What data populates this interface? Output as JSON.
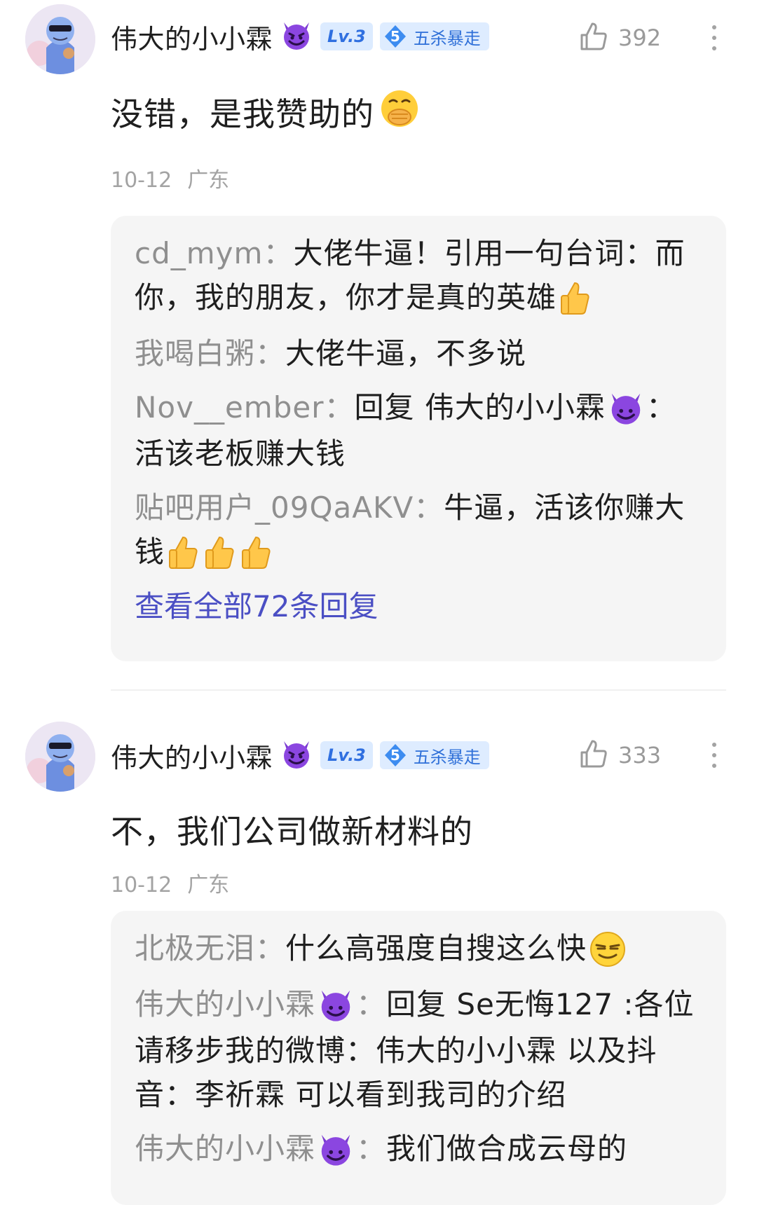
{
  "comments": [
    {
      "username": "伟大的小小霖",
      "level": "Lv.3",
      "title_level": "5",
      "title_text": "五杀暴走",
      "likes": "392",
      "content": "没错，是我赞助的",
      "date": "10-12",
      "location": "广东",
      "replies": [
        {
          "author": "cd_mym",
          "sep": "：",
          "text": "大佬牛逼！引用一句台词：而你，我的朋友，你才是真的英雄"
        },
        {
          "author": "我喝白粥",
          "sep": "：",
          "text": "大佬牛逼，不多说"
        },
        {
          "author": "Nov__ember",
          "sep": "：",
          "text_a": "回复 伟大的小小霖",
          "text_b": "：活该老板赚大钱"
        },
        {
          "author": "贴吧用户_09QaAKV",
          "sep": "：",
          "text": "牛逼，活该你赚大钱"
        }
      ],
      "view_all": "查看全部72条回复"
    },
    {
      "username": "伟大的小小霖",
      "level": "Lv.3",
      "title_level": "5",
      "title_text": "五杀暴走",
      "likes": "333",
      "content": "不，我们公司做新材料的",
      "date": "10-12",
      "location": "广东",
      "replies": [
        {
          "author": "北极无泪",
          "sep": "：",
          "text": "什么高强度自搜这么快"
        },
        {
          "author": "伟大的小小霖",
          "sep": "：",
          "text": "回复 Se无悔127 :各位请移步我的微博：伟大的小小霖 以及抖音：李祈霖 可以看到我司的介绍"
        },
        {
          "author": "伟大的小小霖",
          "sep": "：",
          "text": "我们做合成云母的"
        }
      ]
    }
  ],
  "icons": {
    "badge_emoji": "smiling-devil-icon",
    "like": "thumbs-up-outline-icon",
    "more": "more-vertical-icon",
    "emoji_covering_mouth": "face-hand-over-mouth-icon",
    "emoji_thumbs": "thumbs-up-emoji-icon",
    "emoji_smirk": "smirking-face-icon"
  },
  "colors": {
    "link": "#4b4fc4",
    "reply_author": "#8f8f8f",
    "reply_box_bg": "#f5f5f5",
    "badge_blue": "#2f6fe0",
    "devil_purple": "#7a3bd1"
  }
}
